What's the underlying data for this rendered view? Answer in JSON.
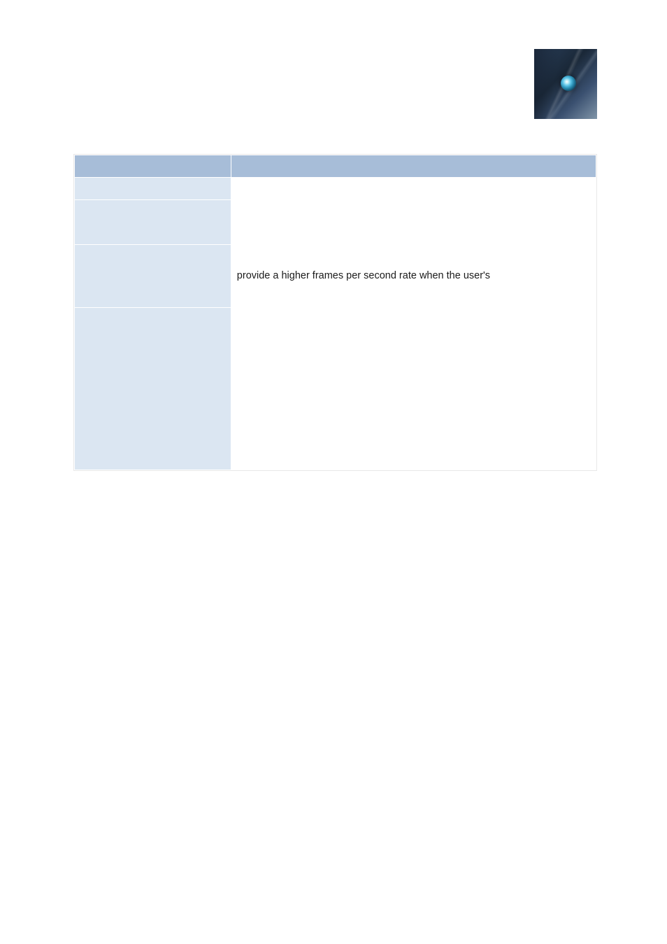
{
  "header": {
    "logo_name": "wolf-eye-image"
  },
  "table": {
    "header": {
      "col1": "",
      "col2": ""
    },
    "rows": [
      {
        "label": "",
        "content": ""
      },
      {
        "label": "",
        "content": ""
      },
      {
        "label": "",
        "content": "provide a higher frames per second rate when the user's"
      },
      {
        "label": "",
        "content": ""
      }
    ]
  }
}
